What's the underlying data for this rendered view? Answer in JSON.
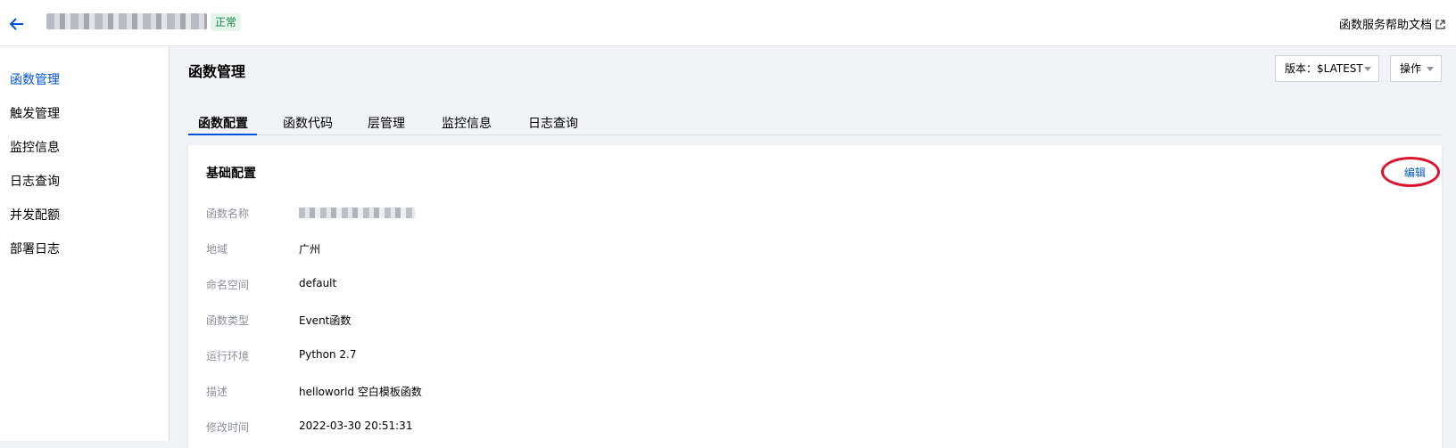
{
  "header": {
    "status": "正常",
    "doc_link": "函数服务帮助文档"
  },
  "sidebar": {
    "items": [
      {
        "label": "函数管理",
        "active": true
      },
      {
        "label": "触发管理"
      },
      {
        "label": "监控信息"
      },
      {
        "label": "日志查询"
      },
      {
        "label": "并发配额"
      },
      {
        "label": "部署日志"
      }
    ]
  },
  "main": {
    "title": "函数管理",
    "version_label": "版本：$LATEST",
    "action_label": "操作",
    "tabs": [
      {
        "label": "函数配置",
        "active": true
      },
      {
        "label": "函数代码"
      },
      {
        "label": "层管理"
      },
      {
        "label": "监控信息"
      },
      {
        "label": "日志查询"
      }
    ]
  },
  "config_card": {
    "title": "基础配置",
    "edit_label": "编辑",
    "rows": [
      {
        "label": "函数名称",
        "value": ""
      },
      {
        "label": "地域",
        "value": "广州"
      },
      {
        "label": "命名空间",
        "value": "default"
      },
      {
        "label": "函数类型",
        "value": "Event函数"
      },
      {
        "label": "运行环境",
        "value": "Python 2.7"
      },
      {
        "label": "描述",
        "value": "helloworld 空白模板函数"
      },
      {
        "label": "修改时间",
        "value": "2022-03-30 20:51:31"
      }
    ]
  },
  "colors": {
    "accent": "#0052d9",
    "highlight": "#d9142b",
    "status": "#1a7f4b"
  }
}
